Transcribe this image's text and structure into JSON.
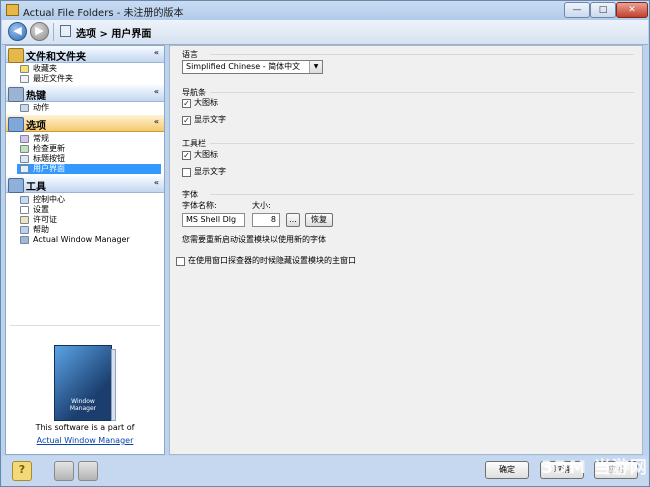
{
  "window": {
    "title": "Actual File Folders - 未注册的版本",
    "min": "—",
    "max": "□",
    "close": "✕"
  },
  "nav": {
    "back": "◀",
    "forward": "▶",
    "breadcrumb": "选项 > 用户界面"
  },
  "sidebar": {
    "sections": [
      {
        "title": "文件和文件夹",
        "items": [
          "收藏夹",
          "最近文件夹"
        ]
      },
      {
        "title": "热键",
        "items": [
          "动作"
        ]
      },
      {
        "title": "选项",
        "items": [
          "常规",
          "检查更新",
          "标题按钮",
          "用户界面"
        ],
        "selected_index": 3
      },
      {
        "title": "工具",
        "items": [
          "控制中心",
          "设置",
          "许可证",
          "帮助",
          "Actual Window Manager"
        ]
      }
    ],
    "chevron": "«",
    "promo": {
      "box_text": "Window Manager",
      "line1": "This software is a part of",
      "link": "Actual Window Manager"
    }
  },
  "settings": {
    "language": {
      "label": "语言",
      "value": "Simplified Chinese - 简体中文"
    },
    "navbar": {
      "label": "导航条",
      "large_icons": "大图标",
      "large_icons_checked": true,
      "show_text": "显示文字",
      "show_text_checked": true
    },
    "toolbar": {
      "label": "工具栏",
      "large_icons": "大图标",
      "large_icons_checked": true,
      "show_text": "显示文字",
      "show_text_checked": false
    },
    "font": {
      "label": "字体",
      "name_label": "字体名称:",
      "size_label": "大小:",
      "name_value": "MS Shell Dlg",
      "size_value": "8",
      "browse": "...",
      "reset": "恢复",
      "note": "您需要重新启动设置模块以使用新的字体"
    },
    "hide_main": {
      "label": "在使用窗口探查器的时候隐藏设置模块的主窗口",
      "checked": false
    }
  },
  "buttons": {
    "ok": "确定",
    "cancel": "取消",
    "apply": "应用",
    "help_icon": "?"
  },
  "watermark": "3DM 当游网"
}
